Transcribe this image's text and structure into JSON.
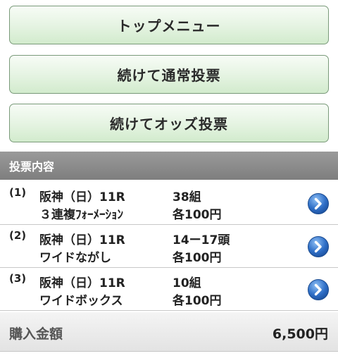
{
  "buttons": {
    "top_menu": "トップメニュー",
    "continue_normal": "続けて通常投票",
    "continue_odds": "続けてオッズ投票"
  },
  "section": {
    "title": "投票内容"
  },
  "bets": [
    {
      "index": "(1)",
      "race": "阪神（日）11R",
      "type": "３連複ﾌｫｰﾒｰｼｮﾝ",
      "count": "38組",
      "amount": "各100円"
    },
    {
      "index": "(2)",
      "race": "阪神（日）11R",
      "type": "ワイドながし",
      "count": "14ー17頭",
      "amount": "各100円"
    },
    {
      "index": "(3)",
      "race": "阪神（日）11R",
      "type": "ワイドボックス",
      "count": "10組",
      "amount": "各100円"
    }
  ],
  "total": {
    "label": "購入金額",
    "value": "6,500円"
  },
  "colors": {
    "button_bg": "#e6f4e3",
    "header_bg": "#8a8a8a",
    "arrow_blue": "#2f6fc7"
  }
}
